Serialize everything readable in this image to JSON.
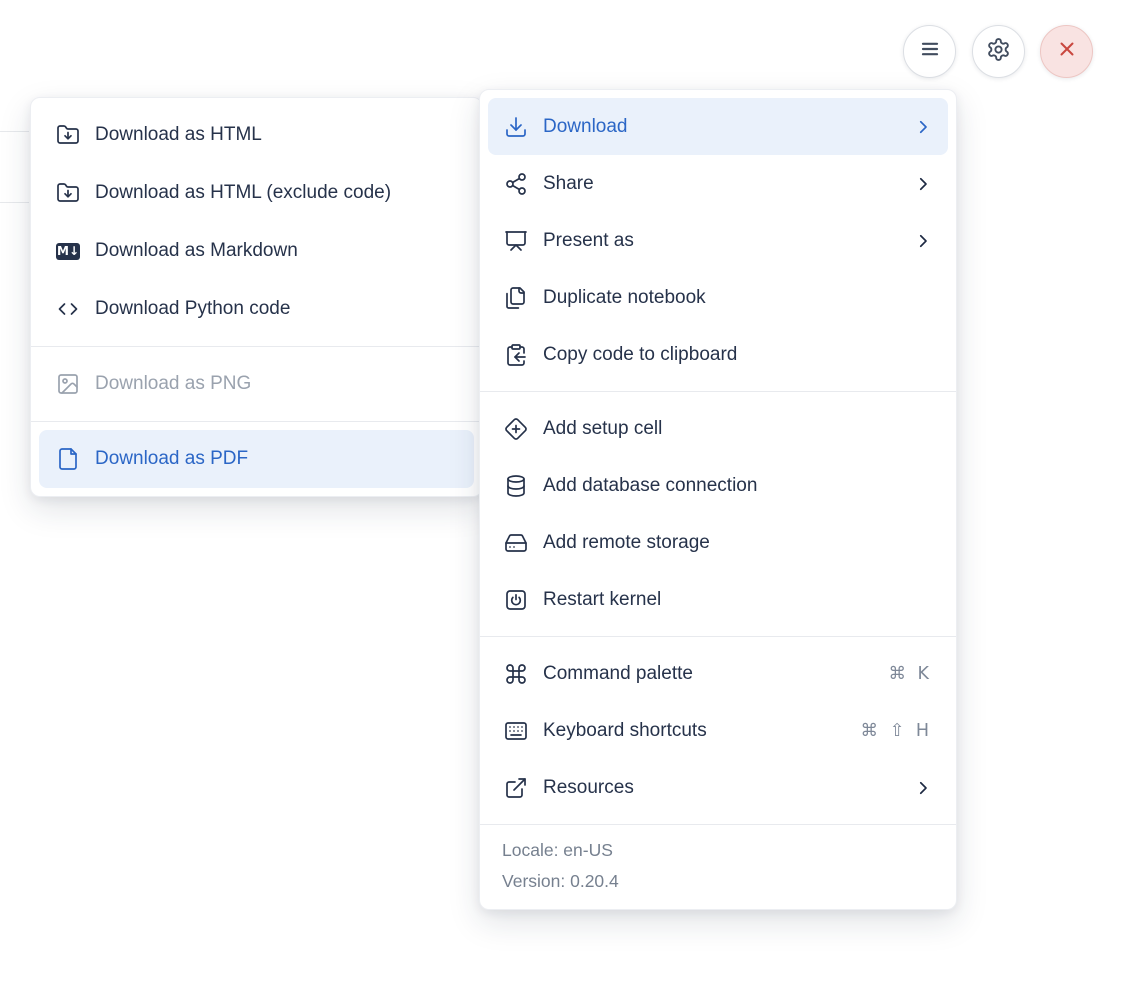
{
  "toolbar": {
    "buttons": [
      {
        "icon": "hamburger-icon",
        "purpose": "open menu"
      },
      {
        "icon": "gear-icon",
        "purpose": "settings"
      },
      {
        "icon": "close-x-icon",
        "purpose": "close"
      }
    ]
  },
  "download_submenu": {
    "groups": [
      {
        "items": [
          {
            "label": "Download as HTML",
            "icon": "folder-download-icon",
            "state": "normal"
          },
          {
            "label": "Download as HTML (exclude code)",
            "icon": "folder-download-icon",
            "state": "normal"
          },
          {
            "label": "Download as Markdown",
            "icon": "markdown-badge-icon",
            "badge": "M↓",
            "state": "normal"
          },
          {
            "label": "Download Python code",
            "icon": "code-icon",
            "state": "normal"
          }
        ]
      },
      {
        "items": [
          {
            "label": "Download as PNG",
            "icon": "image-icon",
            "state": "disabled"
          }
        ]
      },
      {
        "items": [
          {
            "label": "Download as PDF",
            "icon": "file-icon",
            "state": "active"
          }
        ]
      }
    ]
  },
  "main_menu": {
    "groups": [
      {
        "items": [
          {
            "label": "Download",
            "icon": "download-icon",
            "has_submenu": true,
            "state": "active"
          },
          {
            "label": "Share",
            "icon": "share-icon",
            "has_submenu": true,
            "state": "normal"
          },
          {
            "label": "Present as",
            "icon": "presentation-icon",
            "has_submenu": true,
            "state": "normal"
          },
          {
            "label": "Duplicate notebook",
            "icon": "duplicate-files-icon",
            "state": "normal"
          },
          {
            "label": "Copy code to clipboard",
            "icon": "clipboard-copy-icon",
            "state": "normal"
          }
        ]
      },
      {
        "items": [
          {
            "label": "Add setup cell",
            "icon": "diamond-plus-icon",
            "state": "normal"
          },
          {
            "label": "Add database connection",
            "icon": "database-icon",
            "state": "normal"
          },
          {
            "label": "Add remote storage",
            "icon": "hard-drive-icon",
            "state": "normal"
          },
          {
            "label": "Restart kernel",
            "icon": "power-square-icon",
            "state": "normal"
          }
        ]
      },
      {
        "items": [
          {
            "label": "Command palette",
            "icon": "command-icon",
            "shortcut": "⌘ K",
            "state": "normal"
          },
          {
            "label": "Keyboard shortcuts",
            "icon": "keyboard-icon",
            "shortcut": "⌘ ⇧ H",
            "state": "normal"
          },
          {
            "label": "Resources",
            "icon": "external-link-icon",
            "has_submenu": true,
            "state": "normal"
          }
        ]
      }
    ],
    "footer": {
      "locale": "Locale: en-US",
      "version": "Version: 0.20.4"
    }
  },
  "colors": {
    "accent_blue": "#2b66c6",
    "active_row_bg": "#eaf1fb",
    "text_dark": "#26324a",
    "text_disabled": "#9aa2ae",
    "text_muted": "#76808f",
    "shortcut_gray": "#7e8898",
    "separator": "#e8eaee",
    "danger_red": "#c9473f",
    "danger_bg": "#f9e3e2"
  }
}
